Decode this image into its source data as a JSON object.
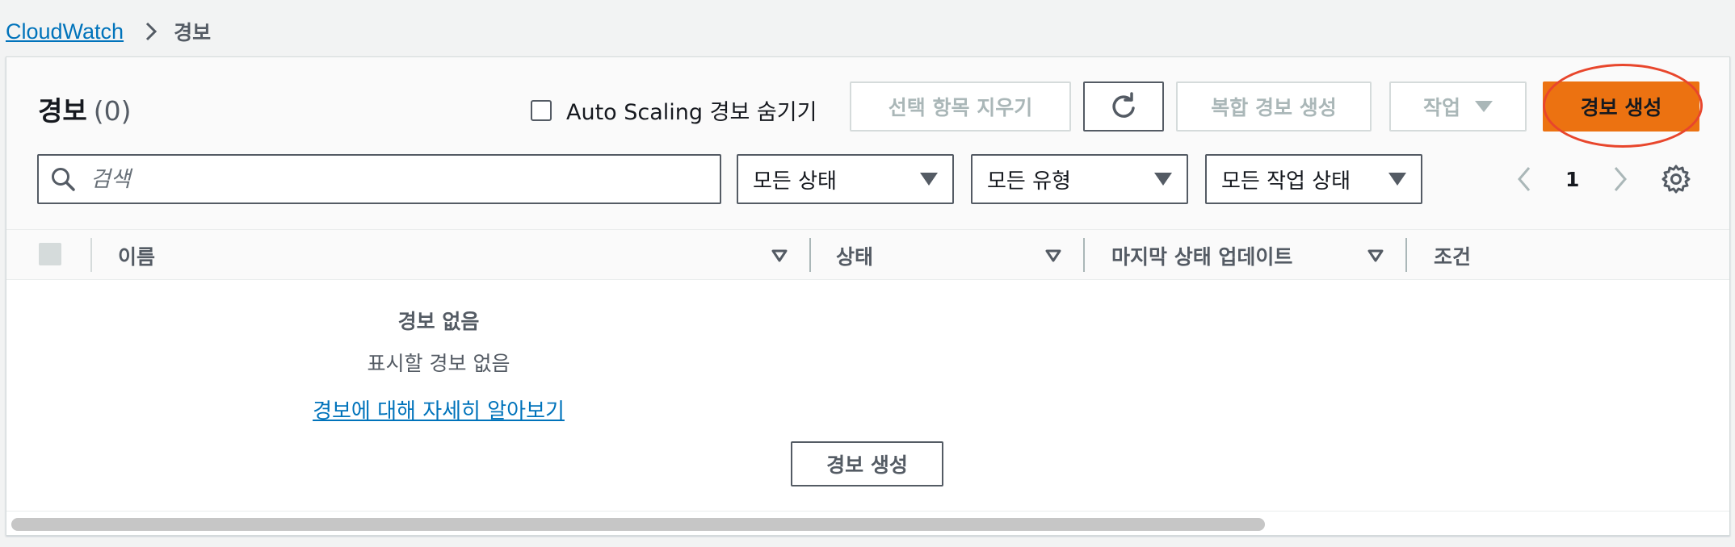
{
  "breadcrumb": {
    "root": "CloudWatch",
    "current": "경보"
  },
  "header": {
    "title": "경보",
    "count": "(0)"
  },
  "options": {
    "hide_autoscaling_label": "Auto Scaling 경보 숨기기"
  },
  "toolbar": {
    "clear_selection": "선택 항목 지우기",
    "create_composite": "복합 경보 생성",
    "actions": "작업",
    "create_alarm": "경보 생성"
  },
  "filters": {
    "search_placeholder": "검색",
    "state": "모든 상태",
    "type": "모든 유형",
    "action_state": "모든 작업 상태"
  },
  "pagination": {
    "page": "1"
  },
  "table": {
    "columns": [
      "이름",
      "상태",
      "마지막 상태 업데이트",
      "조건"
    ]
  },
  "empty_state": {
    "title": "경보 없음",
    "description": "표시할 경보 없음",
    "learn_more": "경보에 대해 자세히 알아보기",
    "create_button": "경보 생성"
  },
  "colors": {
    "primary": "#ec7211",
    "link": "#0073bb",
    "highlight": "#e8462c"
  }
}
